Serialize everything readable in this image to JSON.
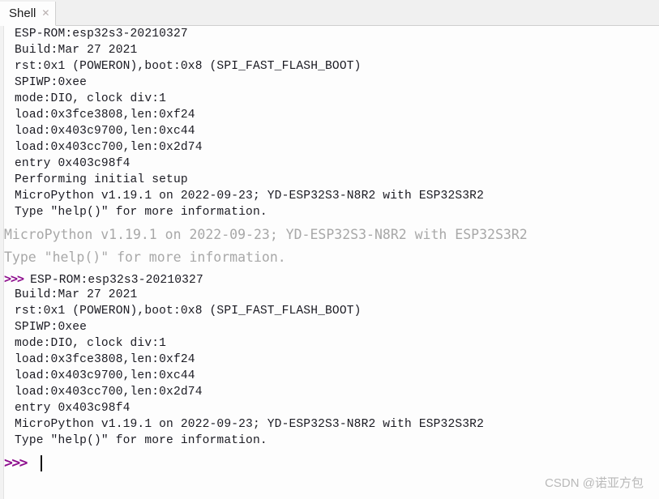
{
  "window": {
    "title": "Shell"
  },
  "tabbar": {
    "tabs": [
      {
        "label": "Shell",
        "close_icon": "close-icon",
        "active": true
      }
    ]
  },
  "shell": {
    "prompt_symbol": ">>>",
    "cursor_visible": true,
    "blocks": [
      {
        "style": "output",
        "lines": [
          "ESP-ROM:esp32s3-20210327",
          "Build:Mar 27 2021",
          "rst:0x1 (POWERON),boot:0x8 (SPI_FAST_FLASH_BOOT)",
          "SPIWP:0xee",
          "mode:DIO, clock div:1",
          "load:0x3fce3808,len:0xf24",
          "load:0x403c9700,len:0xc44",
          "load:0x403cc700,len:0x2d74",
          "entry 0x403c98f4",
          "Performing initial setup",
          "MicroPython v1.19.1 on 2022-09-23; YD-ESP32S3-N8R2 with ESP32S3R2",
          "Type \"help()\" for more information."
        ]
      },
      {
        "style": "banner-grey",
        "lines": [
          "MicroPython v1.19.1 on 2022-09-23; YD-ESP32S3-N8R2 with ESP32S3R2",
          "Type \"help()\" for more information."
        ]
      },
      {
        "style": "prompt-output",
        "prompt_line": "ESP-ROM:esp32s3-20210327",
        "lines": [
          "Build:Mar 27 2021",
          "rst:0x1 (POWERON),boot:0x8 (SPI_FAST_FLASH_BOOT)",
          "SPIWP:0xee",
          "mode:DIO, clock div:1",
          "load:0x3fce3808,len:0xf24",
          "load:0x403c9700,len:0xc44",
          "load:0x403cc700,len:0x2d74",
          "entry 0x403c98f4",
          "MicroPython v1.19.1 on 2022-09-23; YD-ESP32S3-N8R2 with ESP32S3R2",
          "Type \"help()\" for more information."
        ]
      }
    ]
  },
  "watermark": {
    "text": "CSDN @诺亚方包"
  },
  "colors": {
    "prompt": "#8e0f8e",
    "output_text": "#1a1a22",
    "banner_grey": "#a8a8a8",
    "background": "#fdfdfd",
    "tabbar_background": "#f0f0f0",
    "tab_active_background": "#fdfdfd",
    "border": "#cfcfcf",
    "watermark": "#b9b9b9",
    "caret": "#111111"
  }
}
